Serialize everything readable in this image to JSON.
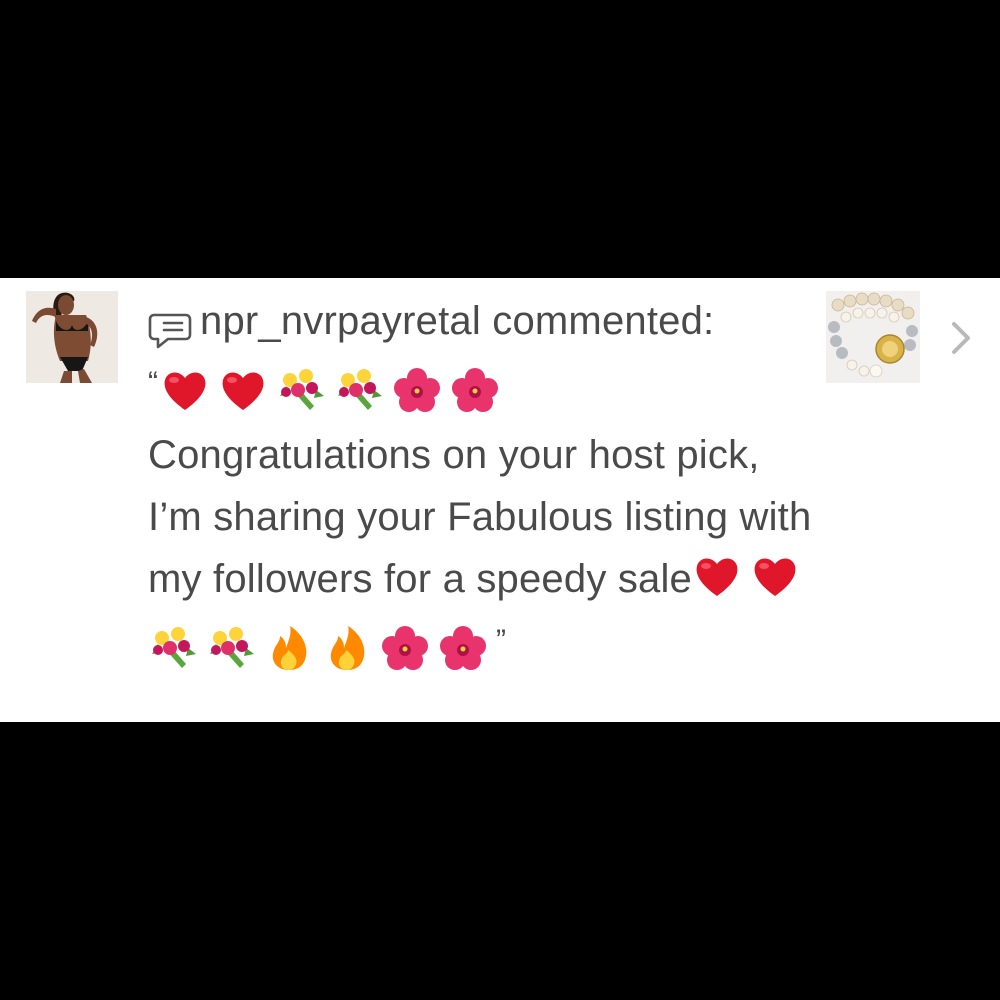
{
  "notification": {
    "username": "npr_nvrpayretal",
    "action_text": "commented:",
    "open_quote": "“",
    "close_quote": "”",
    "message": "Congratulations on your host pick, I’m sharing your Fabulous listing with my followers for a speedy sale",
    "leading_emojis": [
      "heart-emoji",
      "heart-emoji",
      "bouquet-emoji",
      "bouquet-emoji",
      "hibiscus-emoji",
      "hibiscus-emoji"
    ],
    "trailing_emojis": [
      "heart-emoji",
      "heart-emoji",
      "bouquet-emoji",
      "bouquet-emoji",
      "fire-emoji",
      "fire-emoji",
      "hibiscus-emoji",
      "hibiscus-emoji"
    ]
  },
  "icons": {
    "comment": "speech-bubble-icon",
    "chevron": "chevron-right-icon"
  },
  "colors": {
    "background": "#000000",
    "row_background": "#ffffff",
    "text": "#4a4a4a",
    "chevron": "#b9b9b9",
    "heart": "#e0162b",
    "hibiscus": "#e8336d",
    "fire": "#ff8a00"
  }
}
